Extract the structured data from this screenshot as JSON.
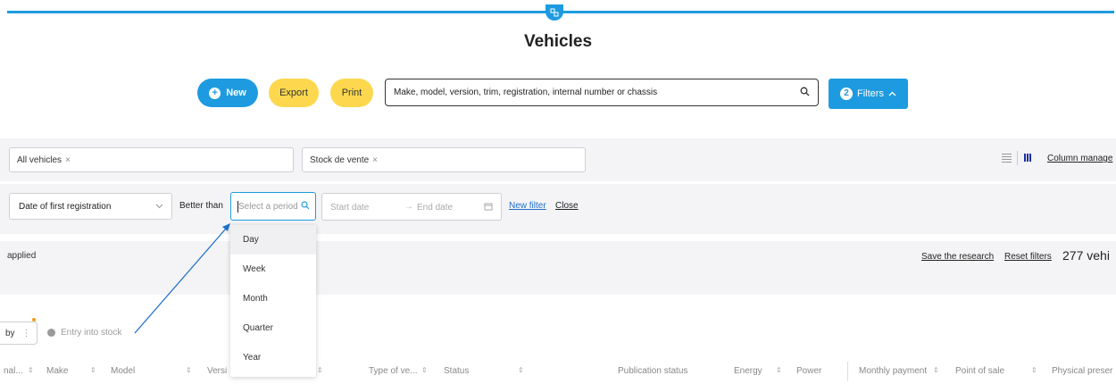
{
  "header": {
    "title": "Vehicles"
  },
  "toolbar": {
    "new_label": "New",
    "export_label": "Export",
    "print_label": "Print",
    "search_placeholder": "Make, model, version, trim, registration, internal number or chassis",
    "filters_label": "Filters",
    "filters_count": "2"
  },
  "saved_filters": [
    {
      "label": "All vehicles"
    },
    {
      "label": "Stock de vente"
    }
  ],
  "view": {
    "column_manage_label": "Column manage"
  },
  "filter_row": {
    "field": "Date of first registration",
    "operator": "Better than",
    "period_placeholder": "Select a period",
    "start_date_placeholder": "Start date",
    "end_date_placeholder": "End date",
    "new_filter_label": "New filter",
    "close_label": "Close"
  },
  "period_options": [
    "Day",
    "Week",
    "Month",
    "Quarter",
    "Year"
  ],
  "period_active": "Day",
  "results": {
    "applied_text": "applied",
    "save_research_label": "Save the research",
    "reset_filters_label": "Reset filters",
    "count_text": "277 vehi"
  },
  "sort": {
    "label": "by",
    "dots": "⋮",
    "entry_into_stock": "Entry into stock"
  },
  "table": {
    "columns": [
      "nal...",
      "Make",
      "Model",
      "Versi",
      "Type of ve...",
      "Status",
      "Publication status",
      "Energy",
      "Power",
      "Monthly payment",
      "Point of sale",
      "Physical preser"
    ]
  },
  "colors": {
    "accent": "#1e9be0",
    "yellow": "#fdd84e",
    "band": "#f4f4f6",
    "link": "#1e6fc9"
  }
}
